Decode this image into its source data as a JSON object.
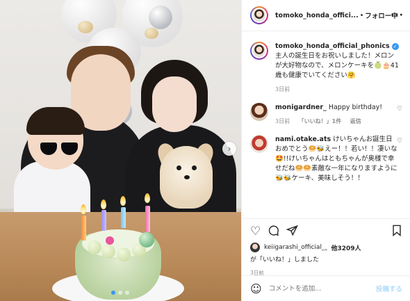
{
  "header": {
    "username": "tomoko_honda_offici...",
    "separator": "•",
    "follow_label": "フォロー中",
    "more_icon": "more-icon"
  },
  "caption": {
    "username": "tomoko_honda_official_phonics",
    "verified": "✓",
    "text": "主人の誕生日をお祝いしました！メロンが大好物なので、メロンケーキを🍈🎂41歳も健康でいてください🤗",
    "time": "3日前"
  },
  "comments": [
    {
      "username": "monigardner_",
      "text": "Happy birthday!",
      "time": "3日前",
      "likes": "「いいね！」1件",
      "reply": "返信"
    },
    {
      "username": "nami.otake.ats",
      "text": "けいちゃんお誕生日おめでとう🥯🐝えー！！若い！！凄いな🤩!!けいちゃんはともちゃんが奥様で幸せだね🥯🥯素敵な一年になりますように🐝🐝ケーキ、美味しそう！！"
    }
  ],
  "actions": {
    "heart_icon": "heart-icon",
    "comment_icon": "comment-icon",
    "share_icon": "share-icon",
    "save_icon": "bookmark-icon"
  },
  "likes": {
    "user": "keiigarashi_official_",
    "others": "他3209人",
    "suffix": "が「いいね！」しました"
  },
  "post_time": "3日前",
  "comment_box": {
    "placeholder": "コメントを追加...",
    "post_label": "投稿する"
  },
  "colors": {
    "verified": "#3897f0",
    "post_disabled": "#b2dffc",
    "meta_gray": "#8e8e8e"
  }
}
